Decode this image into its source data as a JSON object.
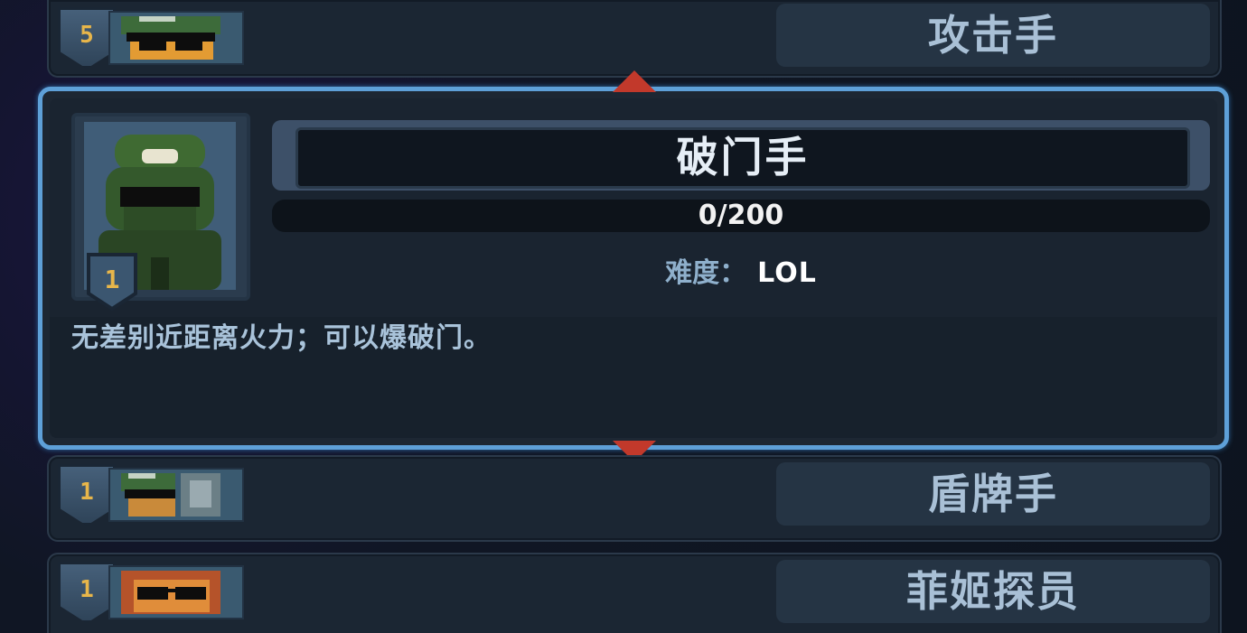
{
  "roster": {
    "top_class": {
      "rank": "5",
      "name": "攻击手"
    },
    "selected": {
      "rank": "1",
      "name": "破门手",
      "progress_text": "0/200",
      "progress_fraction": 0,
      "difficulty_label": "难度：",
      "difficulty_value": "LOL",
      "description": "无差别近距离火力；可以爆破门。"
    },
    "row2": {
      "rank": "1",
      "name": "盾牌手"
    },
    "row3": {
      "rank": "1",
      "name": "菲姬探员"
    }
  },
  "icons": {
    "scroll_up": "arrow-up-icon",
    "scroll_down": "arrow-down-icon"
  },
  "colors": {
    "selection_border": "#5ea0d8",
    "arrow": "#c2392b",
    "rank_text": "#e8b64a"
  }
}
